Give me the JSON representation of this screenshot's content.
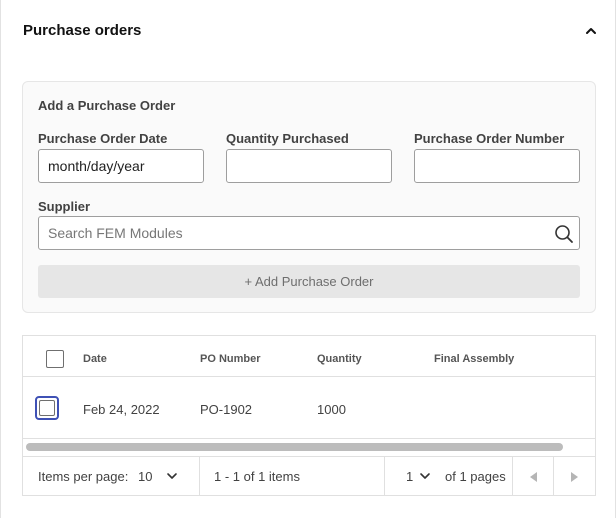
{
  "section": {
    "title": "Purchase orders"
  },
  "form": {
    "heading": "Add a Purchase Order",
    "date_label": "Purchase Order Date",
    "date_value": "month/day/year",
    "qty_label": "Quantity Purchased",
    "qty_value": "",
    "po_number_label": "Purchase Order Number",
    "po_number_value": "",
    "supplier_label": "Supplier",
    "supplier_placeholder": "Search FEM Modules",
    "add_button": "+ Add Purchase Order"
  },
  "grid": {
    "columns": [
      "Date",
      "PO Number",
      "Quantity",
      "Final Assembly"
    ],
    "rows": [
      {
        "date": "Feb 24, 2022",
        "po_number": "PO-1902",
        "quantity": "1000",
        "final_assembly": ""
      }
    ]
  },
  "pager": {
    "items_per_page_label": "Items per page:",
    "items_per_page_value": "10",
    "range_text": "1 - 1 of 1 items",
    "page_value": "1",
    "pages_text": "of 1 pages"
  },
  "colors": {
    "focus_ring": "#3f51b5",
    "button_disabled_bg": "#e6e6e6"
  },
  "icons": [
    "chevron-up-icon",
    "search-icon",
    "chevron-down-icon",
    "caret-left-icon",
    "caret-right-icon"
  ]
}
